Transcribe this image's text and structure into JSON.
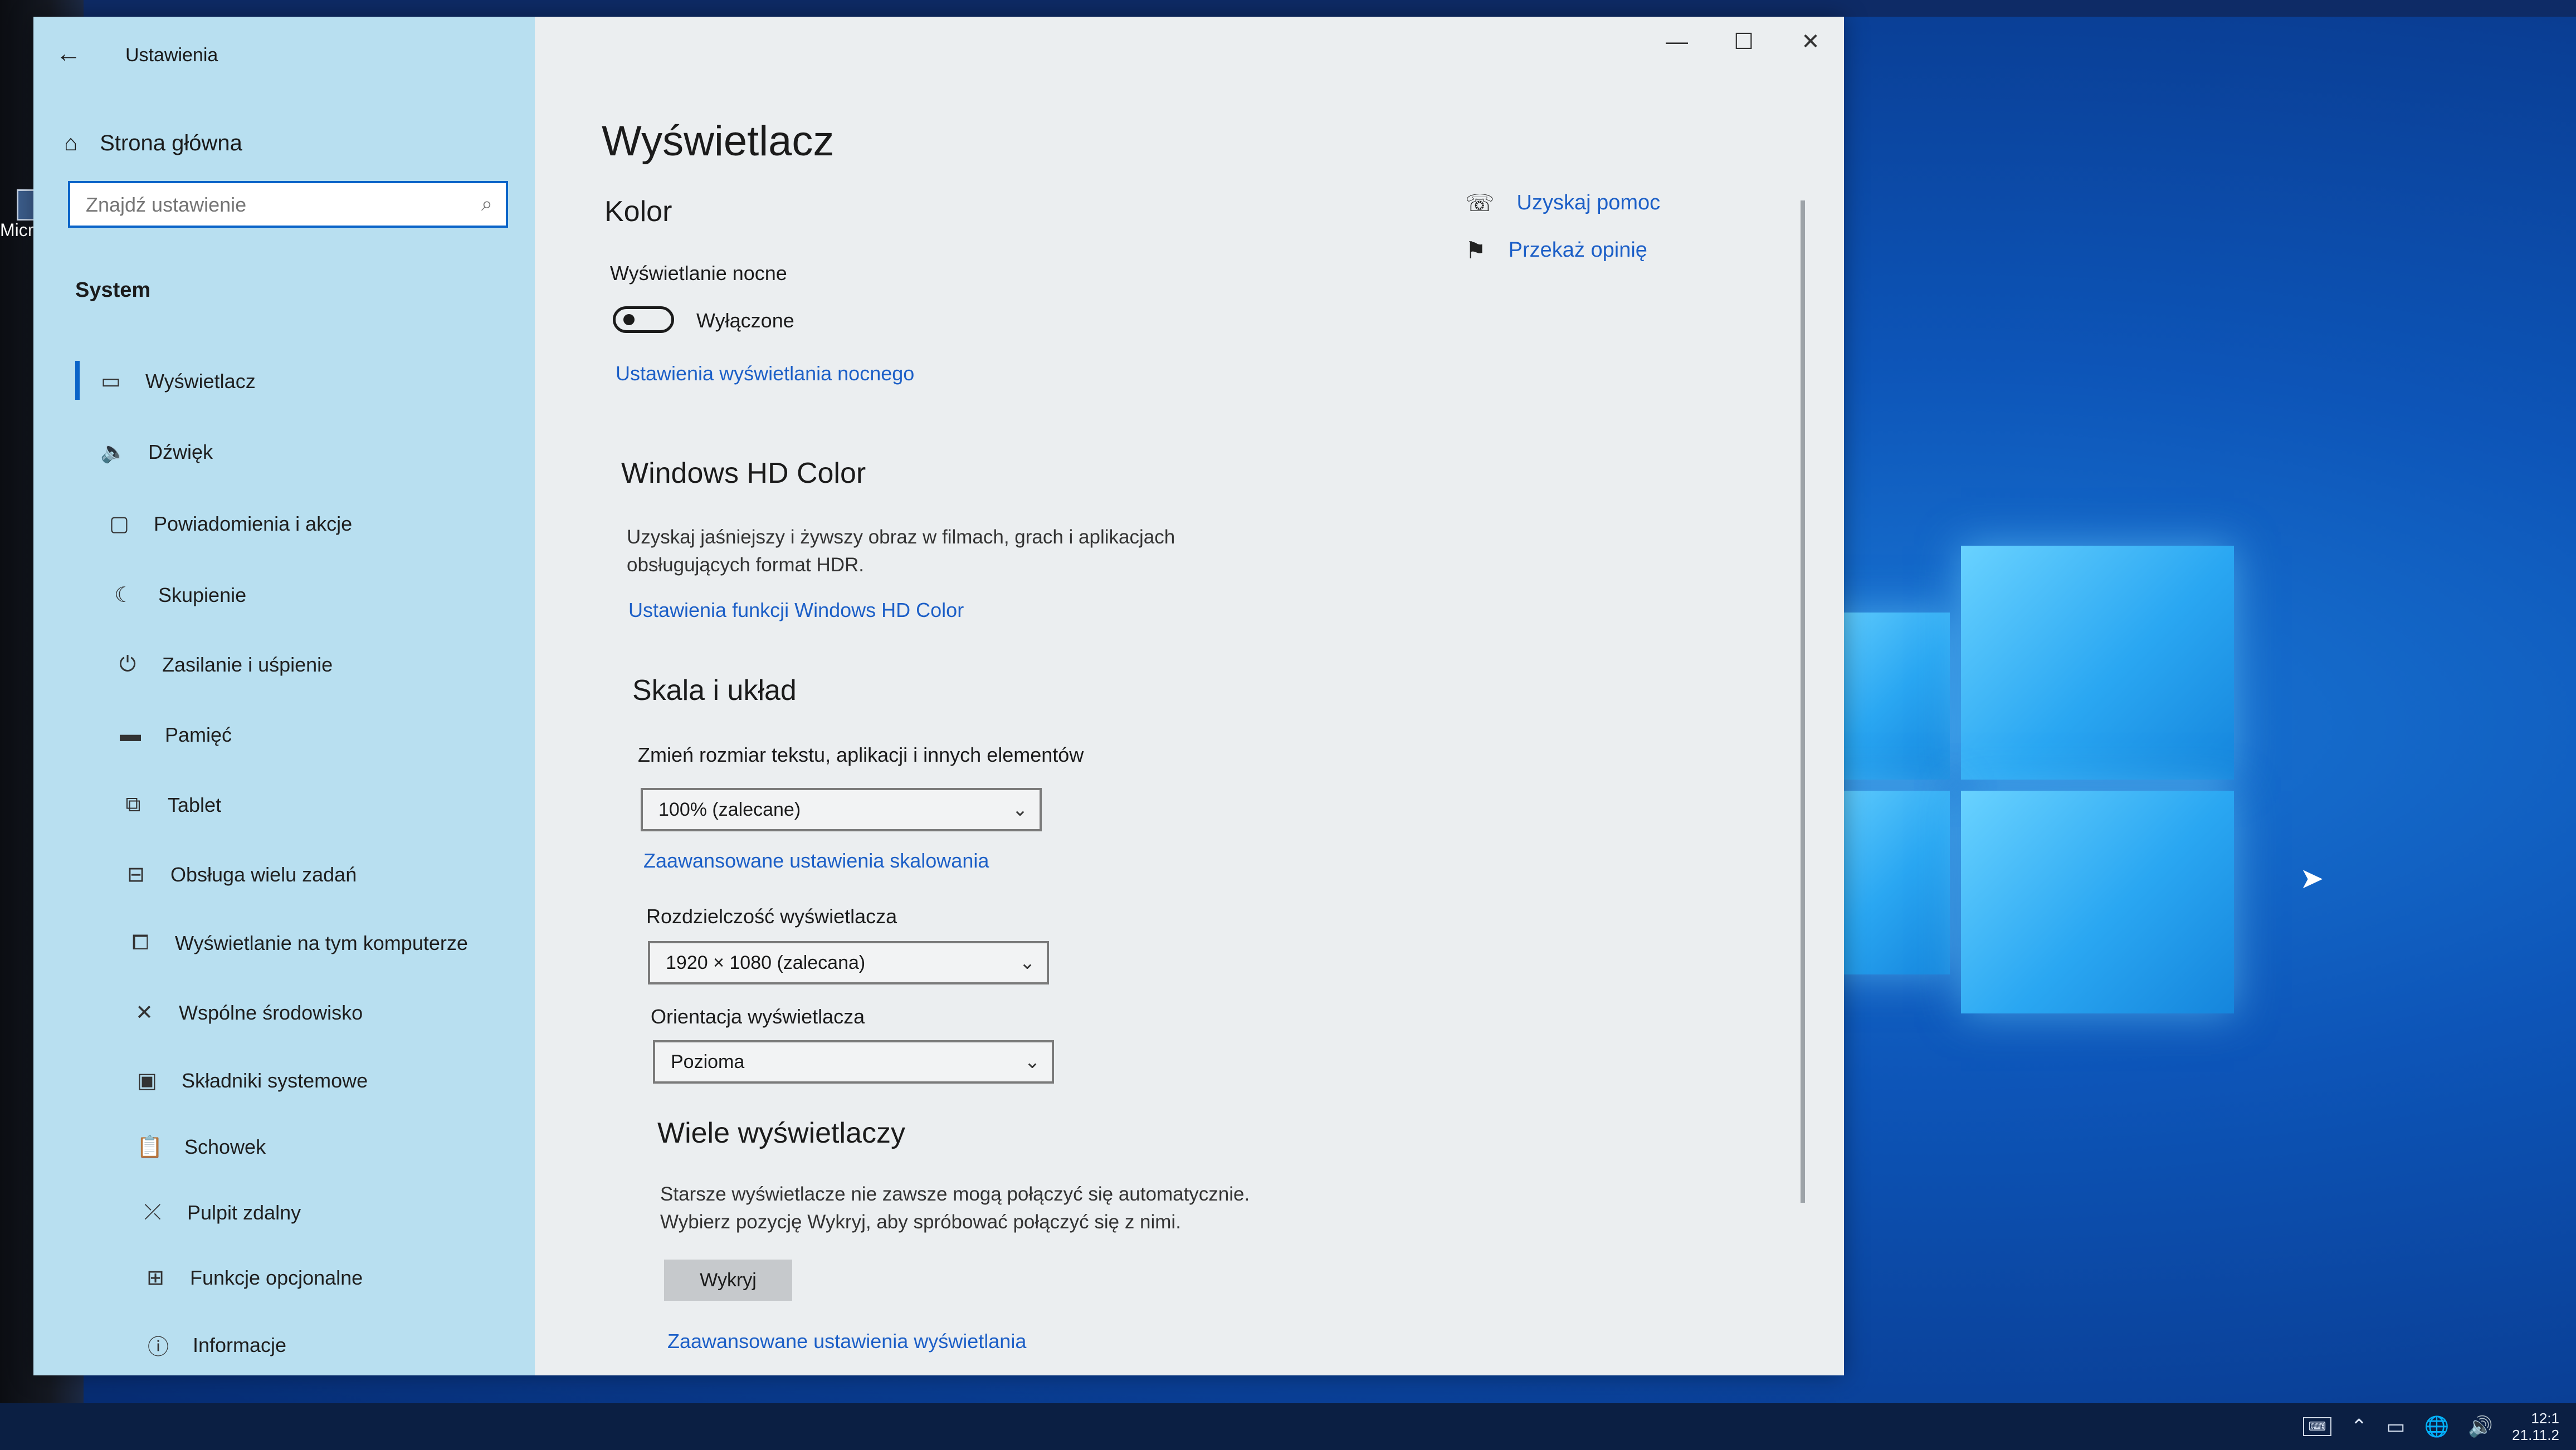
{
  "desktop": {
    "icon_label": "Micro"
  },
  "window": {
    "title": "Ustawienia",
    "controls": {
      "minimize": "—",
      "maximize": "☐",
      "close": "✕"
    }
  },
  "sidebar": {
    "home": "Strona główna",
    "search_placeholder": "Znajdź ustawienie",
    "section": "System",
    "items": [
      {
        "label": "Wyświetlacz",
        "icon": "monitor-icon",
        "active": true
      },
      {
        "label": "Dźwięk",
        "icon": "speaker-icon"
      },
      {
        "label": "Powiadomienia i akcje",
        "icon": "notification-icon"
      },
      {
        "label": "Skupienie",
        "icon": "moon-icon"
      },
      {
        "label": "Zasilanie i uśpienie",
        "icon": "power-icon"
      },
      {
        "label": "Pamięć",
        "icon": "storage-icon"
      },
      {
        "label": "Tablet",
        "icon": "tablet-icon"
      },
      {
        "label": "Obsługa wielu zadań",
        "icon": "multitasking-icon"
      },
      {
        "label": "Wyświetlanie na tym komputerze",
        "icon": "projecting-icon"
      },
      {
        "label": "Wspólne środowisko",
        "icon": "shared-experiences-icon"
      },
      {
        "label": "Składniki systemowe",
        "icon": "system-components-icon"
      },
      {
        "label": "Schowek",
        "icon": "clipboard-icon"
      },
      {
        "label": "Pulpit zdalny",
        "icon": "remote-desktop-icon"
      },
      {
        "label": "Funkcje opcjonalne",
        "icon": "optional-features-icon"
      },
      {
        "label": "Informacje",
        "icon": "info-icon"
      }
    ]
  },
  "main": {
    "title": "Wyświetlacz",
    "color": {
      "heading": "Kolor",
      "night_light_label": "Wyświetlanie nocne",
      "toggle_state": "Wyłączone",
      "night_light_link": "Ustawienia wyświetlania nocnego"
    },
    "hdr": {
      "heading": "Windows HD Color",
      "desc_line1": "Uzyskaj jaśniejszy i żywszy obraz w filmach, grach i aplikacjach",
      "desc_line2": "obsługujących format HDR.",
      "link": "Ustawienia funkcji Windows HD Color"
    },
    "scale": {
      "heading": "Skala i układ",
      "size_label": "Zmień rozmiar tekstu, aplikacji i innych elementów",
      "size_value": "100% (zalecane)",
      "advanced_link": "Zaawansowane ustawienia skalowania",
      "resolution_label": "Rozdzielczość wyświetlacza",
      "resolution_value": "1920 × 1080 (zalecana)",
      "orientation_label": "Orientacja wyświetlacza",
      "orientation_value": "Pozioma"
    },
    "multi": {
      "heading": "Wiele wyświetlaczy",
      "desc_line1": "Starsze wyświetlacze nie zawsze mogą połączyć się automatycznie.",
      "desc_line2": "Wybierz pozycję Wykryj, aby spróbować połączyć się z nimi.",
      "detect_button": "Wykryj",
      "advanced_link": "Zaawansowane ustawienia wyświetlania"
    },
    "help": {
      "get_help": "Uzyskaj pomoc",
      "feedback": "Przekaż opinię"
    }
  },
  "taskbar": {
    "time": "12:1",
    "date": "21.11.2"
  }
}
